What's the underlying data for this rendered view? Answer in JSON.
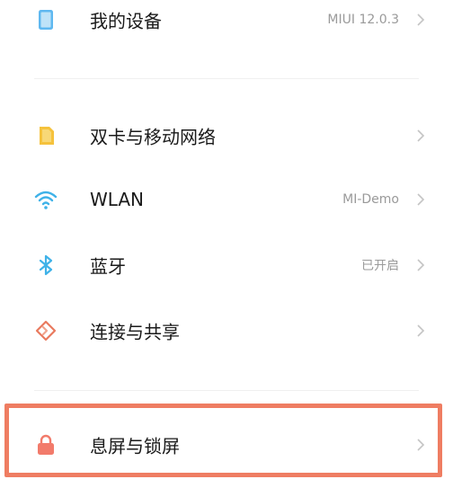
{
  "settings": {
    "items": [
      {
        "label": "我的设备",
        "value": "MIUI 12.0.3",
        "icon": "device-icon"
      },
      {
        "label": "双卡与移动网络",
        "value": "",
        "icon": "sim-icon"
      },
      {
        "label": "WLAN",
        "value": "MI-Demo",
        "icon": "wifi-icon"
      },
      {
        "label": "蓝牙",
        "value": "已开启",
        "icon": "bluetooth-icon"
      },
      {
        "label": "连接与共享",
        "value": "",
        "icon": "connect-share-icon"
      },
      {
        "label": "息屏与锁屏",
        "value": "",
        "icon": "lock-icon"
      }
    ]
  },
  "colors": {
    "highlight_border": "#ef7d62",
    "device_icon": "#5fb8f0",
    "sim_icon": "#f5c23c",
    "wifi_icon": "#3fb2e8",
    "bluetooth_icon": "#3fb2e8",
    "connect_icon": "#e97a5e",
    "lock_icon": "#f27b6b"
  }
}
